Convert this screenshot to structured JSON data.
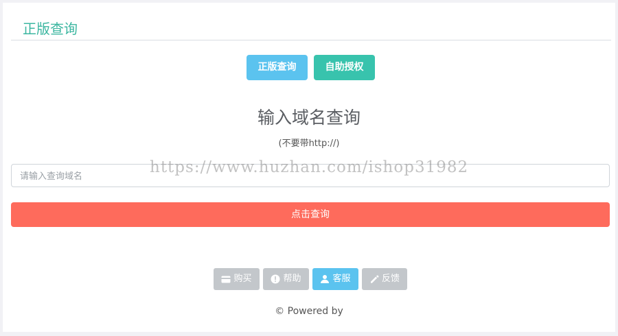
{
  "header": {
    "title": "正版查询"
  },
  "top_actions": {
    "genuine_query_label": "正版查询",
    "self_auth_label": "自助授权"
  },
  "main": {
    "title": "输入域名查询",
    "subtitle": "(不要带http://)",
    "domain_input": {
      "placeholder": "请输入查询域名",
      "value": ""
    },
    "query_button_label": "点击查询"
  },
  "footer_actions": [
    {
      "label": "购买",
      "icon": "card-icon",
      "active": false
    },
    {
      "label": "帮助",
      "icon": "info-circle-icon",
      "active": false
    },
    {
      "label": "客服",
      "icon": "user-icon",
      "active": true
    },
    {
      "label": "反馈",
      "icon": "pencil-icon",
      "active": false
    }
  ],
  "footer": {
    "powered_text": "© Powered by"
  },
  "watermark": {
    "text": "https://www.huzhan.com/ishop31982"
  },
  "colors": {
    "accent_teal": "#3bb6a0",
    "blue_button": "#5bc3ef",
    "teal_button": "#38c3ad",
    "query_red": "#fe6b5c",
    "gray_button": "#c3c7cb"
  }
}
